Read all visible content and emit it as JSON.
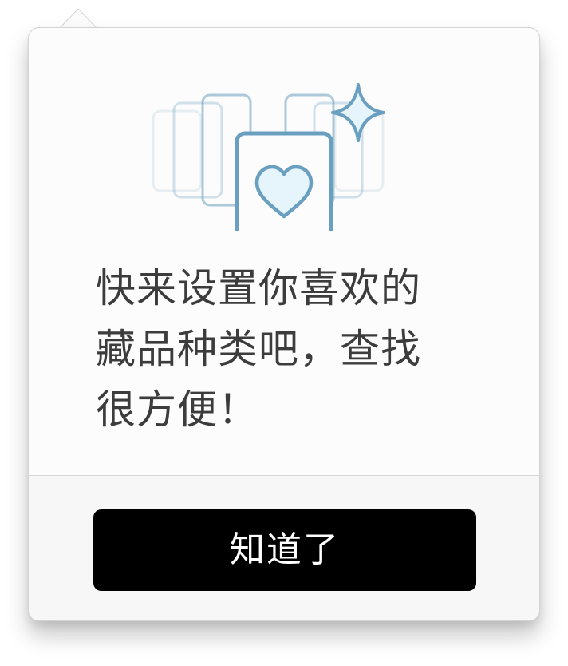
{
  "tip": {
    "message_lines": [
      "快来设置你喜欢的",
      "藏品种类吧，查找",
      "很方便！"
    ],
    "confirm_label": "知道了"
  },
  "illustration": {
    "icons": [
      "card-stack-icon",
      "heart-card-icon",
      "sparkle-icon"
    ],
    "accent_color": "#6a9fbf",
    "heart_fill": "#e6f4fb"
  },
  "colors": {
    "button_bg": "#000000",
    "button_text": "#ffffff",
    "text": "#3c3c3c"
  }
}
